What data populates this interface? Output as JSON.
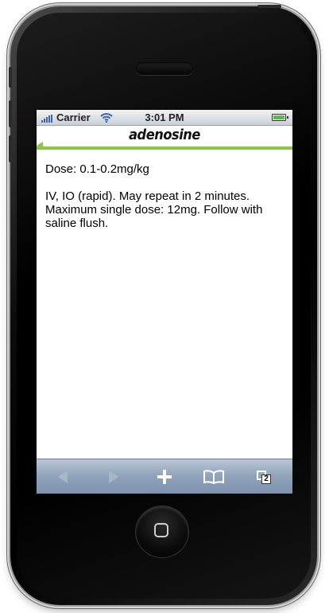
{
  "status_bar": {
    "carrier": "Carrier",
    "time": "3:01 PM"
  },
  "page": {
    "title": "adenosine"
  },
  "content": {
    "paragraphs": [
      "Dose: 0.1-0.2mg/kg",
      "IV, IO (rapid). May repeat in 2 minutes. Maximum single dose: 12mg. Follow with saline flush."
    ]
  },
  "toolbar": {
    "tabs_count": "2",
    "icons": [
      "back-arrow-icon",
      "forward-arrow-icon",
      "plus-icon",
      "bookmarks-icon",
      "tabs-icon"
    ]
  },
  "colors": {
    "accent_green": "#8cc63f",
    "toolbar_blue": "#8fa2ba",
    "battery_green": "#4cc43a"
  }
}
